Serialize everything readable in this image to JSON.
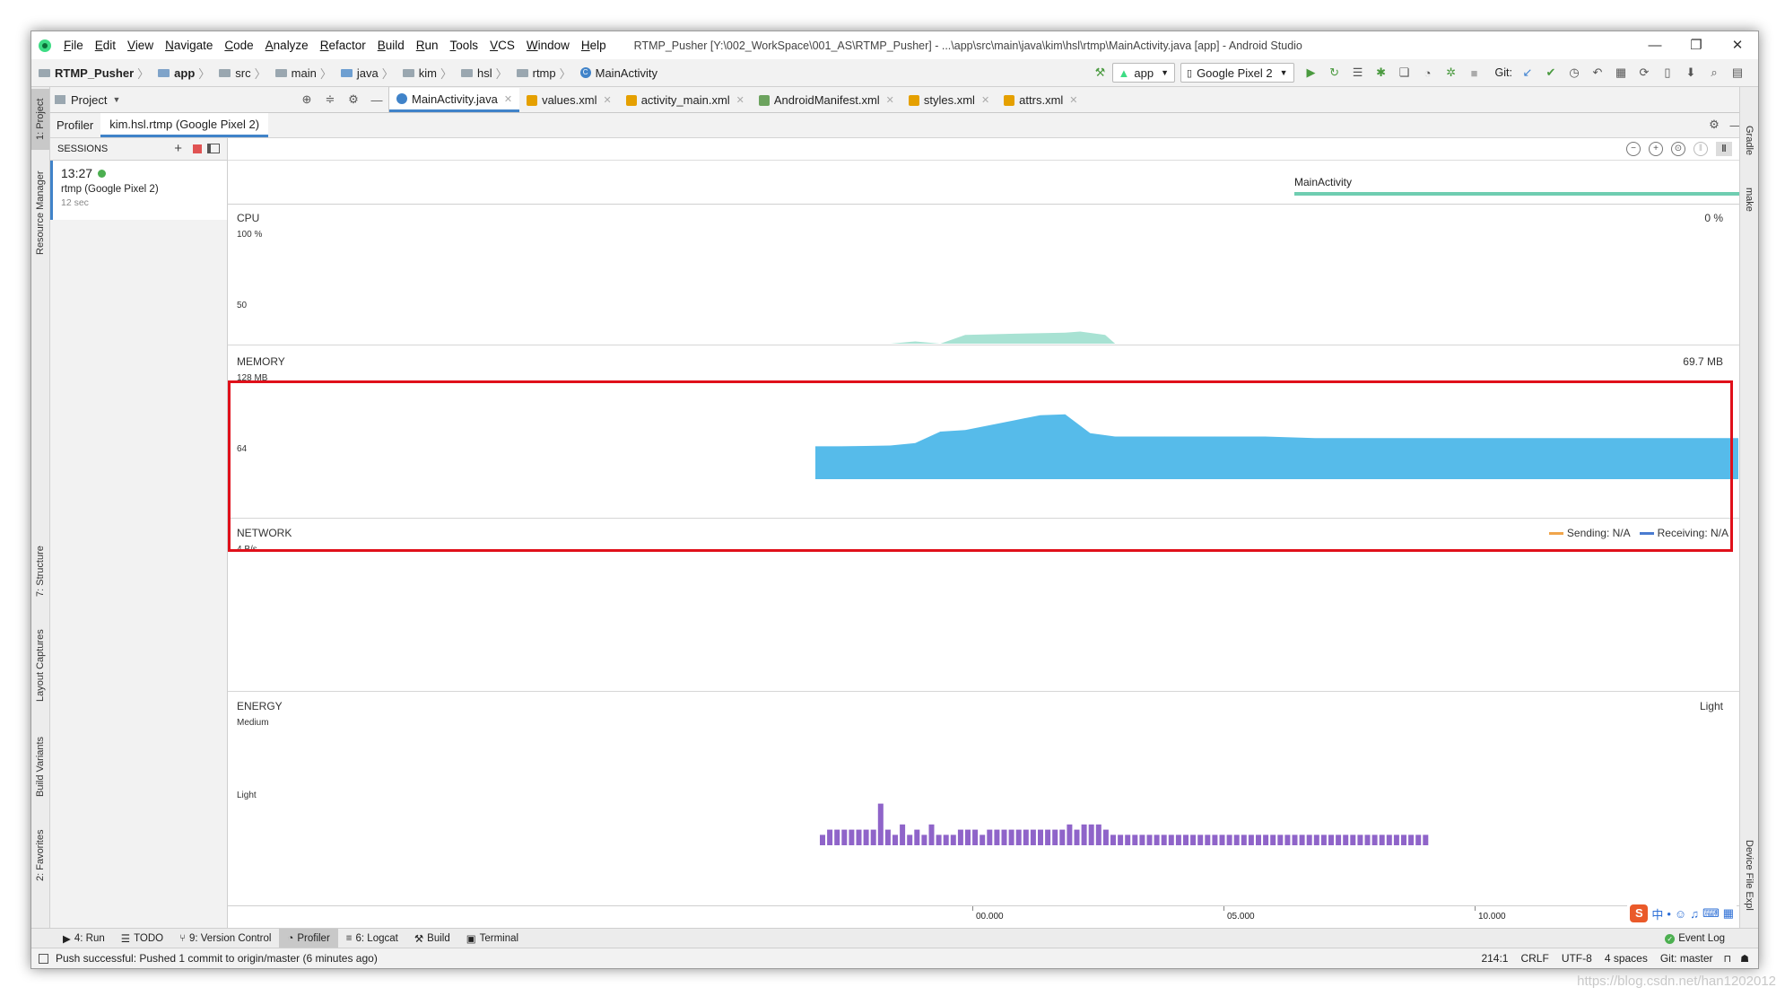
{
  "window": {
    "title": "RTMP_Pusher [Y:\\002_WorkSpace\\001_AS\\RTMP_Pusher] - ...\\app\\src\\main\\java\\kim\\hsl\\rtmp\\MainActivity.java [app] - Android Studio",
    "menus": [
      "File",
      "Edit",
      "View",
      "Navigate",
      "Code",
      "Analyze",
      "Refactor",
      "Build",
      "Run",
      "Tools",
      "VCS",
      "Window",
      "Help"
    ],
    "controls": {
      "minimize": "—",
      "restore": "❐",
      "close": "✕"
    }
  },
  "navbar": {
    "breadcrumbs": [
      "RTMP_Pusher",
      "app",
      "src",
      "main",
      "java",
      "kim",
      "hsl",
      "rtmp",
      "MainActivity"
    ],
    "run_config": "app",
    "device": "Google Pixel 2",
    "git_label": "Git:"
  },
  "project_pane": {
    "label": "Project"
  },
  "editor_tabs": [
    {
      "label": "MainActivity.java",
      "active": true,
      "color": "#4083c9"
    },
    {
      "label": "values.xml",
      "active": false,
      "color": "#e5a000"
    },
    {
      "label": "activity_main.xml",
      "active": false,
      "color": "#e5a000"
    },
    {
      "label": "AndroidManifest.xml",
      "active": false,
      "color": "#6ca35e"
    },
    {
      "label": "styles.xml",
      "active": false,
      "color": "#e5a000"
    },
    {
      "label": "attrs.xml",
      "active": false,
      "color": "#e5a000"
    }
  ],
  "profiler_tabs": {
    "profiler": "Profiler",
    "session": "kim.hsl.rtmp (Google Pixel 2)"
  },
  "sessions": {
    "header": "SESSIONS",
    "item": {
      "time": "13:27",
      "name": "rtmp (Google Pixel 2)",
      "duration": "12 sec"
    }
  },
  "left_tools": [
    "1: Project",
    "Resource Manager",
    "7: Structure",
    "Layout Captures",
    "Build Variants",
    "2: Favorites"
  ],
  "right_tools": [
    "Gradle",
    "make",
    "Device File Expl"
  ],
  "activity": {
    "label": "MainActivity",
    "color": "#6fcdb1"
  },
  "cpu": {
    "title": "CPU",
    "max_label": "100 %",
    "mid_label": "50",
    "current": "0 %",
    "color": "#a8e2d3"
  },
  "memory": {
    "title": "MEMORY",
    "max_label": "128 MB",
    "mid_label": "64",
    "current": "69.7 MB",
    "color": "#56bbea"
  },
  "network": {
    "title": "NETWORK",
    "max_label": "4 B/s",
    "sending": "Sending: N/A",
    "receiving": "Receiving: N/A",
    "sending_color": "#f0a54b",
    "receiving_color": "#4a7bd0"
  },
  "energy": {
    "title": "ENERGY",
    "max_label": "Medium",
    "mid_label": "Light",
    "current": "Light",
    "color": "#8f64c9"
  },
  "timeline": {
    "ticks": [
      "00.000",
      "05.000",
      "10.000"
    ]
  },
  "bottom_tabs": [
    "4: Run",
    "TODO",
    "9: Version Control",
    "Profiler",
    "6: Logcat",
    "Build",
    "Terminal"
  ],
  "event_log": "Event Log",
  "status": {
    "message": "Push successful: Pushed 1 commit to origin/master (6 minutes ago)",
    "position": "214:1",
    "line_sep": "CRLF",
    "encoding": "UTF-8",
    "indent": "4 spaces",
    "vcs": "Git: master"
  },
  "watermark": "https://blog.csdn.net/han1202012",
  "chart_data": [
    {
      "type": "area",
      "title": "MEMORY",
      "ylabel": "MB",
      "ylim": [
        0,
        128
      ],
      "x": [
        0,
        0.5,
        1,
        1.5,
        2,
        2.5,
        3,
        3.5,
        4,
        4.5,
        5,
        5.5,
        6,
        7,
        8,
        9,
        10,
        11,
        12
      ],
      "values": [
        40,
        40,
        40.5,
        41,
        44,
        58,
        60,
        66,
        72,
        78,
        79,
        56,
        52,
        52,
        52,
        52,
        50,
        50,
        50
      ]
    },
    {
      "type": "area",
      "title": "CPU",
      "ylabel": "%",
      "ylim": [
        0,
        100
      ],
      "x": [
        0,
        1.5,
        2,
        2.5,
        3,
        4,
        5,
        5.3,
        5.8,
        6
      ],
      "values": [
        0,
        0,
        2,
        0,
        8,
        9,
        10,
        11,
        8,
        0
      ]
    },
    {
      "type": "bar",
      "title": "ENERGY",
      "values": [
        2,
        3,
        3,
        3,
        3,
        3,
        3,
        3,
        8,
        3,
        2,
        4,
        2,
        3,
        2,
        4,
        2,
        2,
        2,
        3,
        3,
        3,
        2,
        3,
        3,
        3,
        3,
        3,
        3,
        3,
        3,
        3,
        3,
        3,
        4,
        3,
        4,
        4,
        4,
        3,
        2,
        2,
        2,
        2,
        2,
        2,
        2,
        2,
        2,
        2,
        2,
        2,
        2,
        2,
        2,
        2,
        2,
        2,
        2,
        2,
        2,
        2,
        2,
        2,
        2,
        2,
        2,
        2,
        2,
        2,
        2,
        2,
        2,
        2,
        2,
        2,
        2,
        2,
        2,
        2,
        2,
        2,
        2,
        2
      ]
    }
  ]
}
